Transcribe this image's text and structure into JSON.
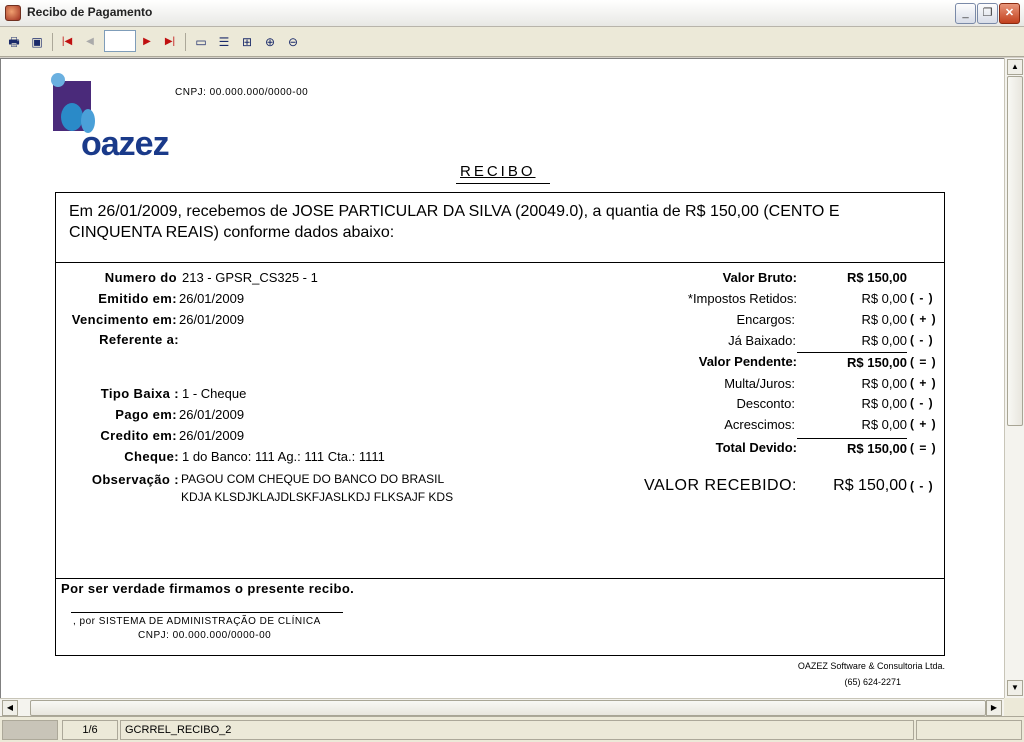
{
  "window": {
    "title": "Recibo de Pagamento"
  },
  "toolbar": {
    "page_value": ""
  },
  "report": {
    "logo_text": "oazez",
    "cnpj_header": "CNPJ: 00.000.000/0000-00",
    "title": "RECIBO",
    "intro": "Em 26/01/2009, recebemos de JOSE PARTICULAR DA SILVA (20049.0),  a quantia de R$ 150,00 (CENTO E CINQUENTA REAIS) conforme dados abaixo:",
    "left_fields": [
      {
        "label": "Numero do",
        "value": "213 - GPSR_CS325 - 1"
      },
      {
        "label": "Emitido em:",
        "value": "26/01/2009"
      },
      {
        "label": "Vencimento em:",
        "value": "26/01/2009"
      },
      {
        "label": "Referente a:",
        "value": ""
      },
      {
        "label": "Tipo Baixa :",
        "value": "1 - Cheque"
      },
      {
        "label": "Pago em:",
        "value": "26/01/2009"
      },
      {
        "label": "Credito em:",
        "value": "26/01/2009"
      },
      {
        "label": "Cheque:",
        "value": "1 do Banco: 111  Ag.: 111  Cta.: 1111"
      },
      {
        "label": "Observação :",
        "value": "PAGOU COM CHEQUE DO BANCO DO BRASIL",
        "value2": "KDJA KLSDJKLAJDLSKFJASLKDJ FLKSAJF KDS"
      }
    ],
    "right_fields": [
      {
        "label": "Valor Bruto:",
        "value": "R$ 150,00",
        "sign": ""
      },
      {
        "label": "*Impostos Retidos:",
        "value": "R$ 0,00",
        "sign": "( - )"
      },
      {
        "label": "Encargos:",
        "value": "R$ 0,00",
        "sign": "( + )"
      },
      {
        "label": "Já Baixado:",
        "value": "R$ 0,00",
        "sign": "( - )"
      },
      {
        "label": "Valor Pendente:",
        "value": "R$ 150,00",
        "sign": "( = )"
      },
      {
        "label": "Multa/Juros:",
        "value": "R$ 0,00",
        "sign": "( + )"
      },
      {
        "label": "Desconto:",
        "value": "R$ 0,00",
        "sign": "( - )"
      },
      {
        "label": "Acrescimos:",
        "value": "R$ 0,00",
        "sign": "( + )"
      },
      {
        "label": "Total Devido:",
        "value": "R$ 150,00",
        "sign": "( = )"
      }
    ],
    "received": {
      "label": "VALOR RECEBIDO:",
      "value": "R$ 150,00",
      "sign": "( - )"
    },
    "closing": "Por ser verdade firmamos o presente recibo.",
    "signer": ", por SISTEMA DE ADMINISTRAÇÃO DE CLÍNICA",
    "signer_cnpj": "CNPJ: 00.000.000/0000-00",
    "company": "OAZEZ Software & Consultoria Ltda.",
    "phone": "(65) 624-2271"
  },
  "status": {
    "page": "1/6",
    "report_name": "GCRREL_RECIBO_2"
  }
}
